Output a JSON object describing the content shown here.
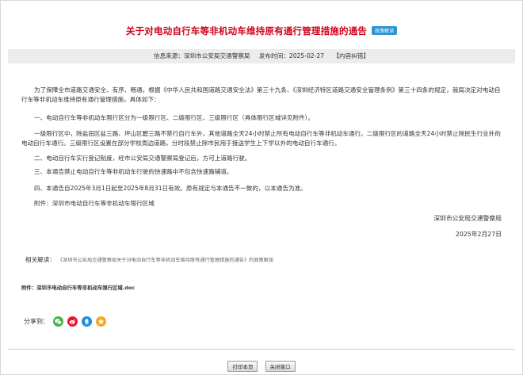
{
  "article": {
    "title": "关于对电动自行车等非机动车维持原有通行管理措施的通告",
    "badge": "政策解读",
    "source_label": "信息来源：",
    "source": "深圳市公安局交通警察局",
    "date_label": "发布时间：",
    "date": "2025-02-27",
    "correction": "【内容纠错】",
    "paragraphs": [
      "为了保障全市道路交通安全、有序、畅通，根据《中华人民共和国道路交通安全法》第三十九条、《深圳经济特区道路交通安全管理条例》第三十四条的规定，我局决定对电动自行车等非机动车维持原有通行管理措施，具体如下：",
      "一、电动自行车等非机动车限行区分为一级限行区、二级限行区、三级限行区（具体限行区域详见附件）。",
      "一级限行区中，除盐田区盐三路、坪山区碧三路不禁行自行车外，其他道路全天24小时禁止所有电动自行车等非机动车通行。二级限行区的道路全天24小时禁止除民生行业外的电动自行车通行。三级限行区设置在部分学校周边道路，分时段禁止除市民用于接送学生上下学以外的电动自行车通行。",
      "二、电动自行车实行登记制度，经市公安局交通警察局登记后，方可上道路行驶。",
      "三、本通告禁止电动自行车等非机动车行驶的快速路中不包含快速路辅道。",
      "四、本通告自2025年3月1日起至2025年8月31日有效。原有规定与本通告不一致的，以本通告为准。",
      "附件：深圳市电动自行车等非机动车限行区域"
    ],
    "signature_org": "深圳市公安局交通警察局",
    "signature_date": "2025年2月27日"
  },
  "related": {
    "label": "相关解读：",
    "link": "《深圳市公安局交通警察局关于对电动自行车等非机动车维持原有通行管理措施的通告》的政策解读"
  },
  "attachment": {
    "label": "附件：",
    "file": "深圳市电动自行车等非机动车限行区域.doc"
  },
  "share": {
    "label": "分享到：",
    "icons": [
      {
        "name": "wechat-icon",
        "color": "#44b549"
      },
      {
        "name": "weibo-icon",
        "color": "#e6162d"
      },
      {
        "name": "qq-icon",
        "color": "#1d8ee0"
      },
      {
        "name": "qzone-icon",
        "color": "#f5a623"
      }
    ]
  },
  "buttons": {
    "print": "打印本页",
    "close": "关闭窗口"
  }
}
